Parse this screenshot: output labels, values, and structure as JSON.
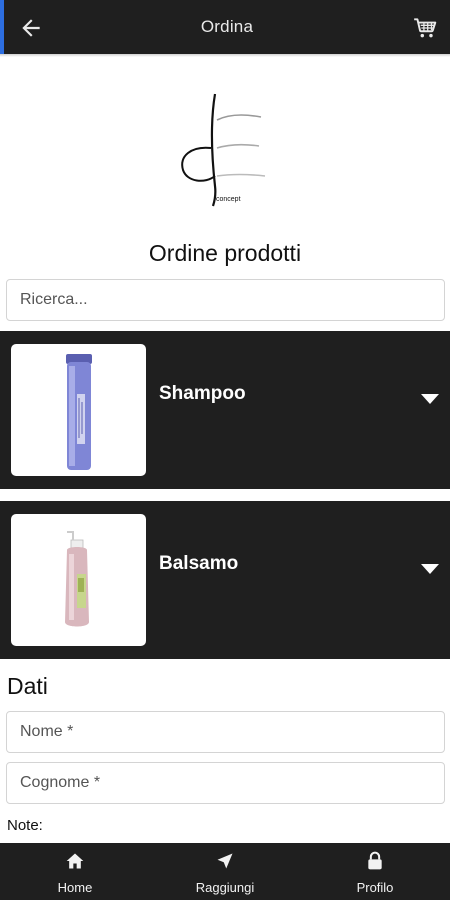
{
  "appbar": {
    "title": "Ordina",
    "back_icon": "arrow-left-icon",
    "cart_icon": "cart-icon"
  },
  "logo": {
    "wordmark": "concept"
  },
  "page_title": "Ordine prodotti",
  "search": {
    "placeholder": "Ricerca..."
  },
  "products": [
    {
      "name": "Shampoo",
      "image": "shampoo-bottle-image",
      "icon": "chevron-down-icon"
    },
    {
      "name": "Balsamo",
      "image": "conditioner-bottle-image",
      "icon": "chevron-down-icon"
    }
  ],
  "form": {
    "section_title": "Dati",
    "nome_placeholder": "Nome *",
    "cognome_placeholder": "Cognome *",
    "note_label": "Note:"
  },
  "bottom_nav": {
    "items": [
      {
        "label": "Home",
        "icon": "home-icon"
      },
      {
        "label": "Raggiungi",
        "icon": "navigation-arrow-icon"
      },
      {
        "label": "Profilo",
        "icon": "lock-icon"
      }
    ]
  },
  "colors": {
    "bar_bg": "#1f1f1f",
    "accent": "#2d6ee0",
    "page_bg": "#ffffff"
  }
}
